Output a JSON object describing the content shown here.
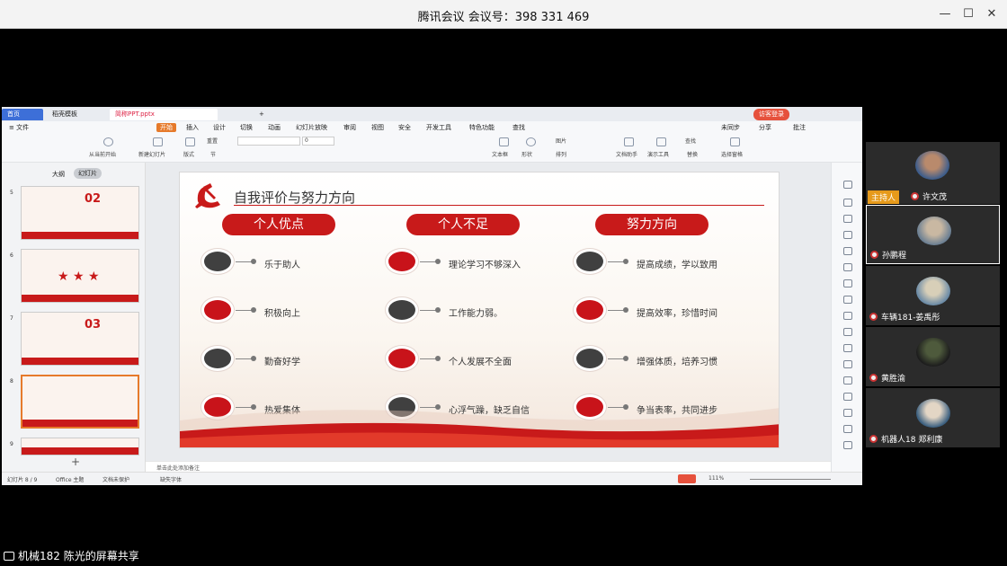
{
  "meeting": {
    "title": "腾讯会议 会议号：398 331 469",
    "share_label": "机械182 陈光的屏幕共享",
    "minimize": "—",
    "maximize": "☐",
    "close": "✕"
  },
  "wps": {
    "tabs": [
      "首页",
      "稻壳模板",
      "简称PPT.pptx"
    ],
    "new_tab": "+",
    "login": "访客登录",
    "menu": [
      "≡ 文件",
      "开始",
      "插入",
      "设计",
      "切换",
      "动画",
      "幻灯片放映",
      "审阅",
      "视图",
      "安全",
      "开发工具",
      "特色功能",
      "查找"
    ],
    "menu_right": [
      "未同步",
      "分享",
      "批注"
    ],
    "ribbon": [
      "从当前开始",
      "新建幻灯片",
      "版式",
      "节",
      "文本框",
      "形状",
      "排列",
      "文档助手",
      "演示工具",
      "替换",
      "选择窗格",
      "重置",
      "图片"
    ],
    "font_size": "0",
    "pane_tabs": [
      "大纲",
      "幻灯片"
    ],
    "thumb_numbers": [
      "5",
      "6",
      "7",
      "8",
      "9"
    ],
    "thumb_titles": [
      "02",
      "",
      "03",
      "",
      ""
    ],
    "notes": "单击此处添加备注",
    "status": {
      "slide": "幻灯片 8 / 9",
      "theme": "Office 主题",
      "protect": "文档未保护",
      "font": "缺失字体",
      "zoom": "111%"
    }
  },
  "slide": {
    "title": "自我评价与努力方向",
    "columns": [
      {
        "header": "个人优点",
        "items": [
          "乐于助人",
          "积极向上",
          "勤奋好学",
          "热爱集体"
        ]
      },
      {
        "header": "个人不足",
        "items": [
          "理论学习不够深入",
          "工作能力弱。",
          "个人发展不全面",
          "心浮气躁，缺乏自信"
        ]
      },
      {
        "header": "努力方向",
        "items": [
          "提高成绩，学以致用",
          "提高效率，珍惜时间",
          "增强体质，培养习惯",
          "争当表率，共同进步"
        ]
      }
    ],
    "dot_colors": [
      [
        "dark",
        "red",
        "dark",
        "red"
      ],
      [
        "red",
        "dark",
        "red",
        "dark"
      ],
      [
        "dark",
        "red",
        "dark",
        "red"
      ]
    ]
  },
  "participants": {
    "host_badge": "主持人",
    "list": [
      "许文茂",
      "孙鹏程",
      "车辆181-姜禹彤",
      "黄胜渝",
      "机器人18 郑利康"
    ]
  },
  "colors": {
    "accent": "#c81a1a",
    "dark_dot": "#404040"
  }
}
